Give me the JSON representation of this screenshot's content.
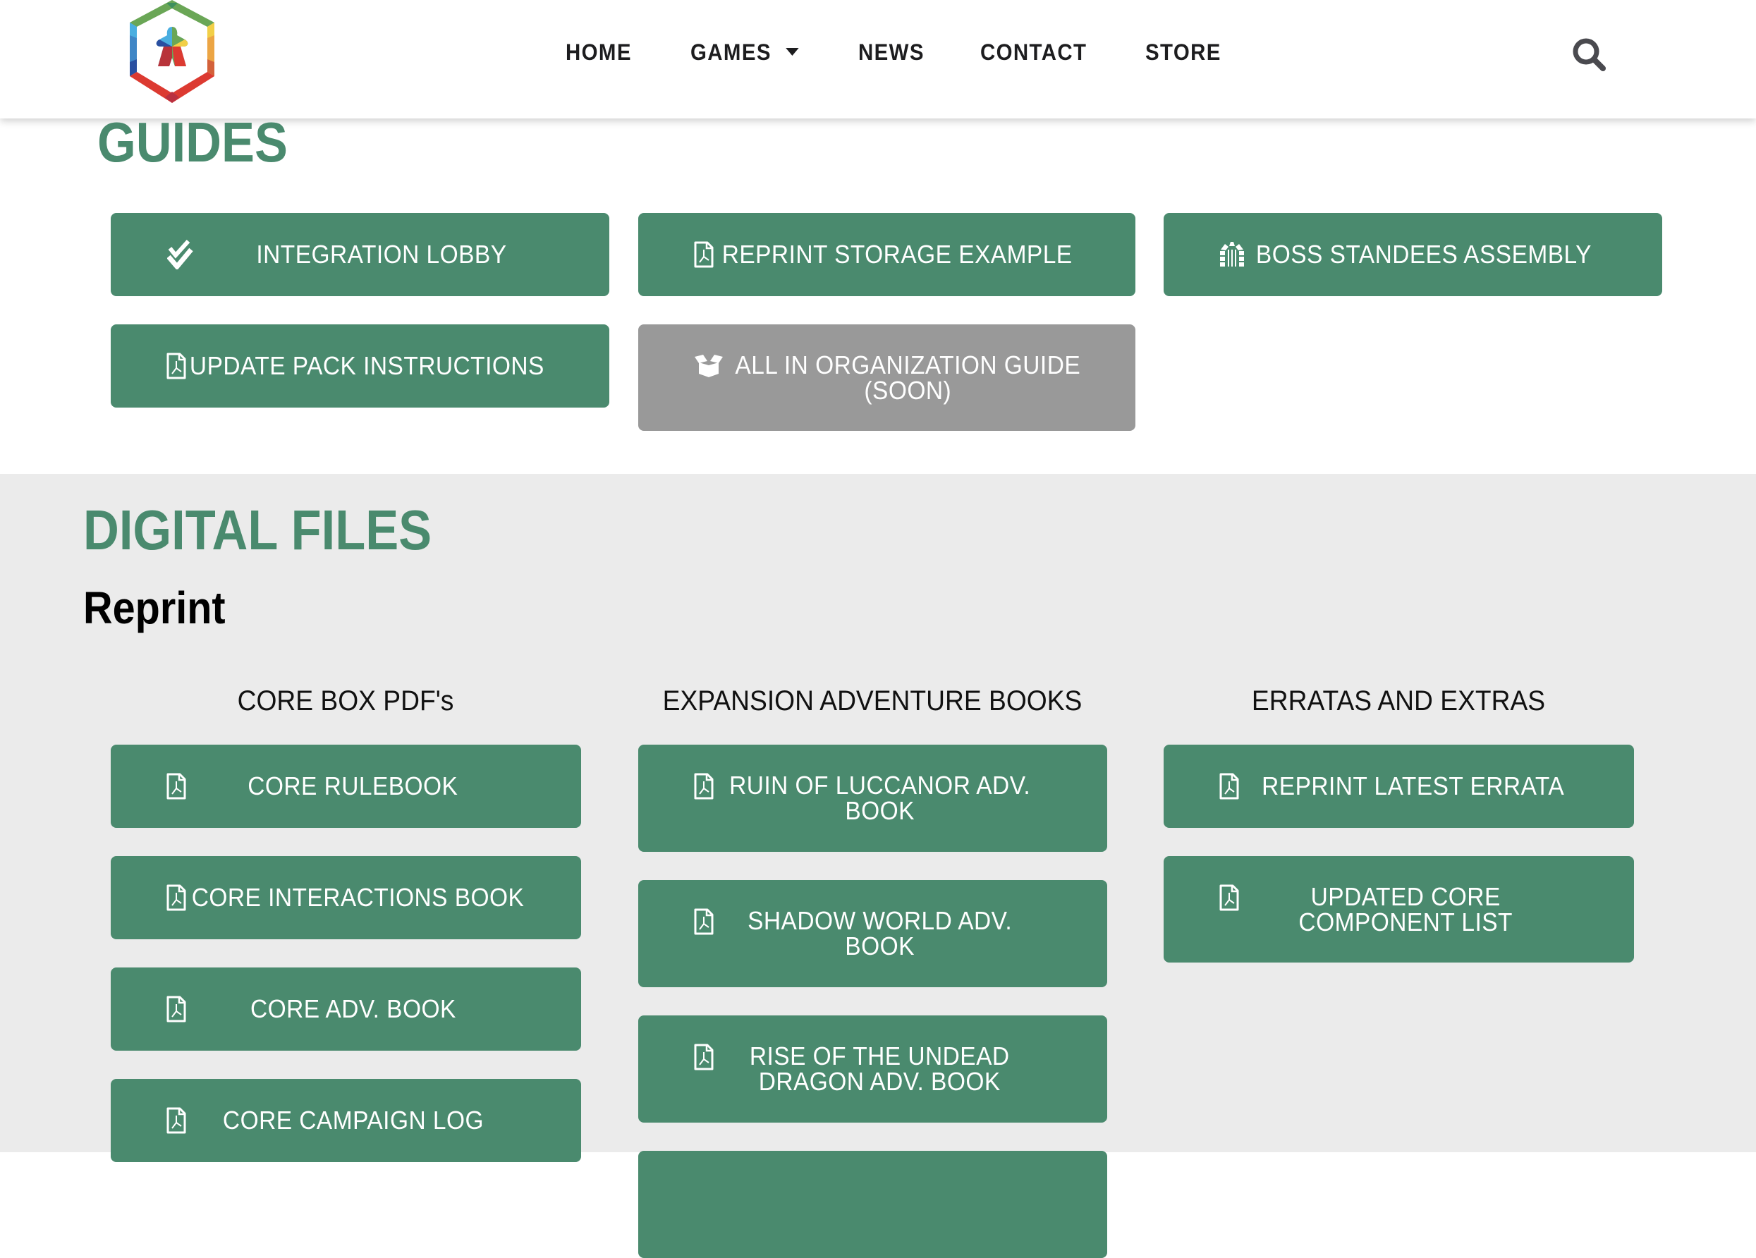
{
  "header": {
    "logo_alt": "site-logo-meeple-hexagon",
    "nav": [
      {
        "label": "HOME"
      },
      {
        "label": "GAMES",
        "has_dropdown": true
      },
      {
        "label": "NEWS"
      },
      {
        "label": "CONTACT"
      },
      {
        "label": "STORE"
      }
    ],
    "search_icon": "search-icon"
  },
  "guides": {
    "title": "GUIDES",
    "buttons": [
      {
        "label": "INTEGRATION LOBBY",
        "icon": "double-check-icon",
        "enabled": true
      },
      {
        "label": "REPRINT STORAGE EXAMPLE",
        "icon": "pdf-file-icon",
        "enabled": true
      },
      {
        "label": "BOSS STANDEES ASSEMBLY",
        "icon": "archway-icon",
        "enabled": true
      },
      {
        "label": "UPDATE PACK INSTRUCTIONS",
        "icon": "pdf-file-icon",
        "enabled": true
      },
      {
        "label": "ALL IN ORGANIZATION GUIDE\n(SOON)",
        "icon": "open-box-icon",
        "enabled": false
      }
    ]
  },
  "digital_files": {
    "title": "DIGITAL FILES",
    "subtitle": "Reprint",
    "columns": [
      {
        "heading": "CORE BOX PDF's",
        "buttons": [
          {
            "label": "CORE RULEBOOK",
            "icon": "pdf-file-icon"
          },
          {
            "label": "CORE INTERACTIONS BOOK",
            "icon": "pdf-file-icon"
          },
          {
            "label": "CORE ADV. BOOK",
            "icon": "pdf-file-icon"
          },
          {
            "label": "CORE CAMPAIGN LOG",
            "icon": "pdf-file-icon"
          }
        ]
      },
      {
        "heading": "EXPANSION ADVENTURE BOOKS",
        "buttons": [
          {
            "label": "RUIN OF LUCCANOR ADV.\nBOOK",
            "icon": "pdf-file-icon"
          },
          {
            "label": "SHADOW WORLD ADV.\nBOOK",
            "icon": "pdf-file-icon"
          },
          {
            "label": "RISE OF THE UNDEAD\nDRAGON ADV. BOOK",
            "icon": "pdf-file-icon"
          },
          {
            "label": "",
            "icon": ""
          }
        ]
      },
      {
        "heading": "ERRATAS AND EXTRAS",
        "buttons": [
          {
            "label": "REPRINT LATEST ERRATA",
            "icon": "pdf-file-icon"
          },
          {
            "label": "UPDATED CORE\nCOMPONENT LIST",
            "icon": "pdf-file-icon"
          }
        ]
      }
    ]
  },
  "colors": {
    "brand_green": "#4a8a6e",
    "disabled_gray": "#999999",
    "section_bg": "#ebebeb",
    "nav_text": "#1d1d1f"
  }
}
